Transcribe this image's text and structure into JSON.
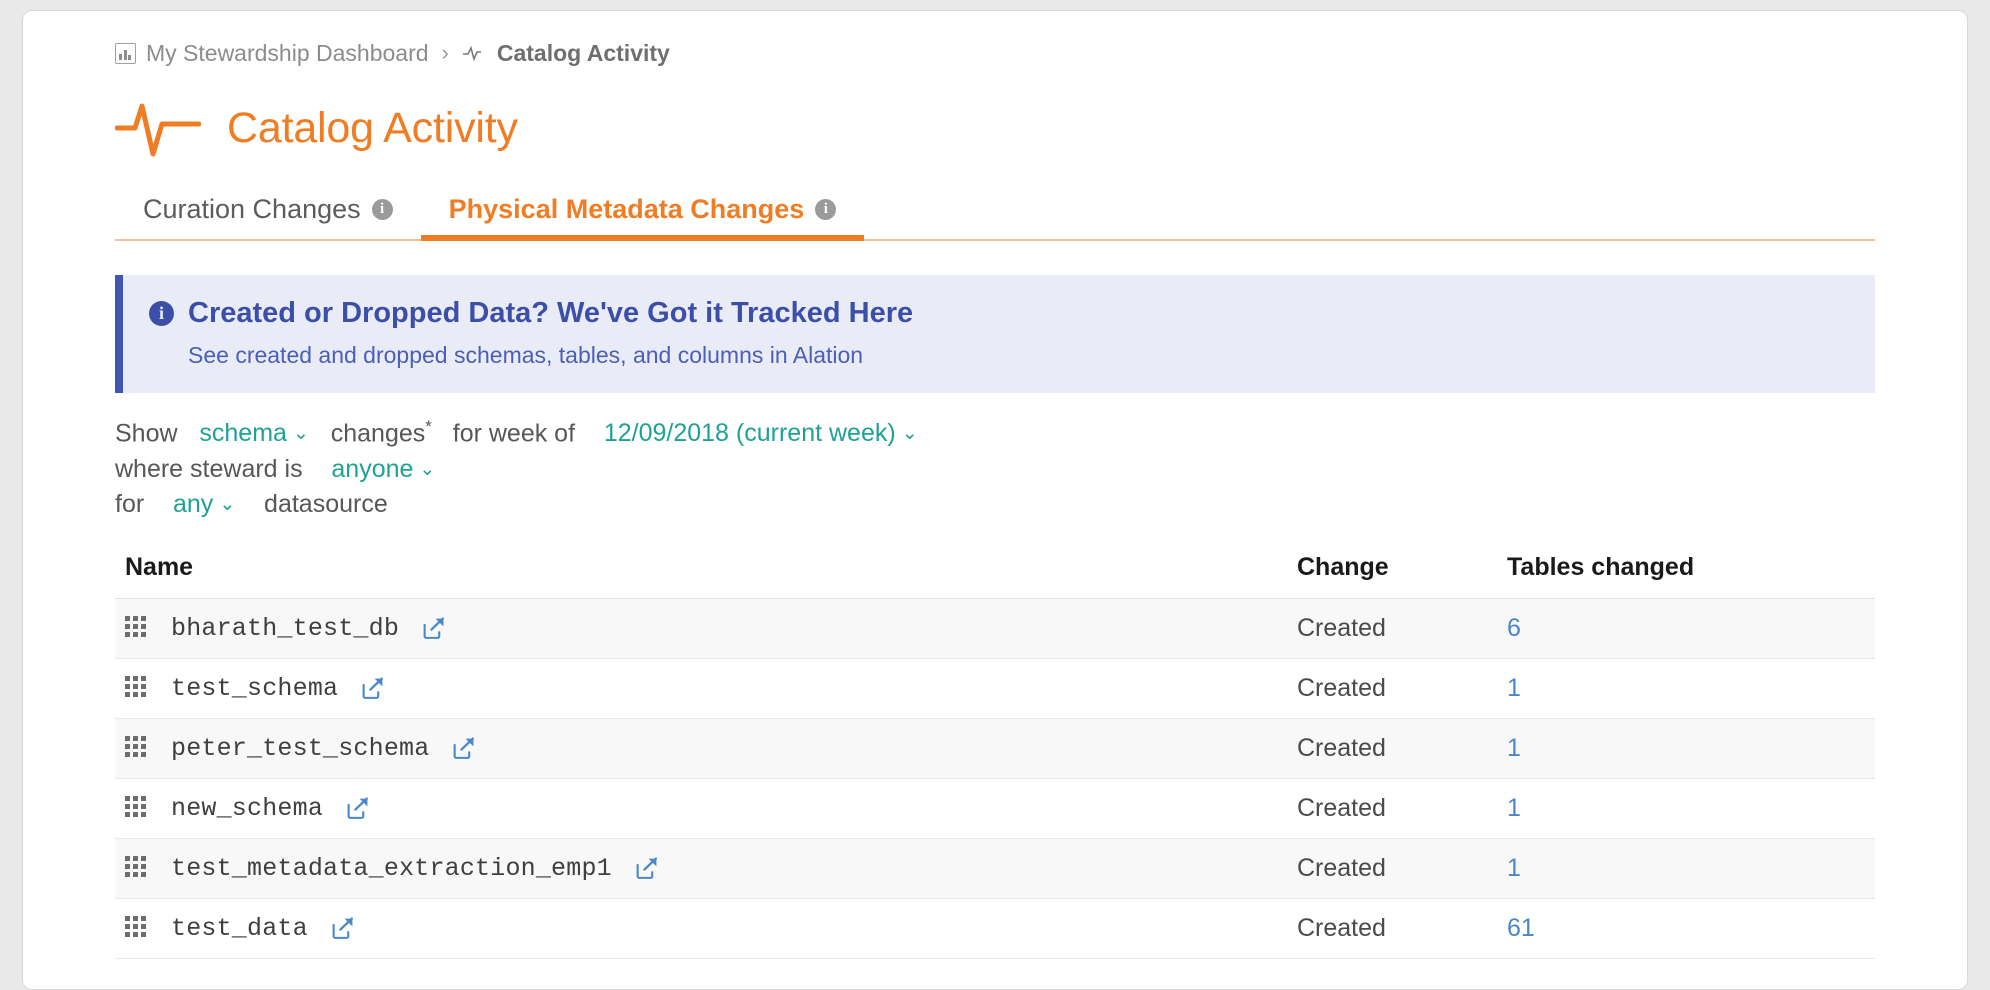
{
  "breadcrumb": {
    "root_label": "My Stewardship Dashboard",
    "separator": "›",
    "current_label": "Catalog Activity",
    "root_icon": "bar-chart-icon",
    "current_icon": "pulse-icon"
  },
  "header": {
    "title": "Catalog Activity",
    "icon": "pulse-icon",
    "accent_color": "#f07c24"
  },
  "tabs": [
    {
      "label": "Curation Changes",
      "active": false,
      "info_icon": "info-icon"
    },
    {
      "label": "Physical Metadata Changes",
      "active": true,
      "info_icon": "info-icon"
    }
  ],
  "banner": {
    "icon": "info-icon",
    "title": "Created or Dropped Data? We've Got it Tracked Here",
    "subtitle": "See created and dropped schemas, tables, and columns in Alation",
    "accent_color": "#4056b0",
    "background_color": "#e9ecf7"
  },
  "filters": {
    "line1": {
      "prefix": "Show",
      "object_type": "schema",
      "middle": "changes",
      "asterisk": "*",
      "mid2": "for week of",
      "week": "12/09/2018 (current week)"
    },
    "line2": {
      "prefix": "where steward is",
      "steward": "anyone"
    },
    "line3": {
      "prefix": "for",
      "datasource": "any",
      "suffix": "datasource"
    },
    "token_color": "#1fa195"
  },
  "table": {
    "columns": [
      "Name",
      "Change",
      "Tables changed"
    ],
    "rows": [
      {
        "name": "bharath_test_db",
        "change": "Created",
        "tables_changed": "6",
        "icon": "grid-icon",
        "link_icon": "external-link-icon"
      },
      {
        "name": "test_schema",
        "change": "Created",
        "tables_changed": "1",
        "icon": "grid-icon",
        "link_icon": "external-link-icon"
      },
      {
        "name": "peter_test_schema",
        "change": "Created",
        "tables_changed": "1",
        "icon": "grid-icon",
        "link_icon": "external-link-icon"
      },
      {
        "name": "new_schema",
        "change": "Created",
        "tables_changed": "1",
        "icon": "grid-icon",
        "link_icon": "external-link-icon"
      },
      {
        "name": "test_metadata_extraction_emp1",
        "change": "Created",
        "tables_changed": "1",
        "icon": "grid-icon",
        "link_icon": "external-link-icon"
      },
      {
        "name": "test_data",
        "change": "Created",
        "tables_changed": "61",
        "icon": "grid-icon",
        "link_icon": "external-link-icon"
      }
    ],
    "link_color": "#4a87c8"
  }
}
